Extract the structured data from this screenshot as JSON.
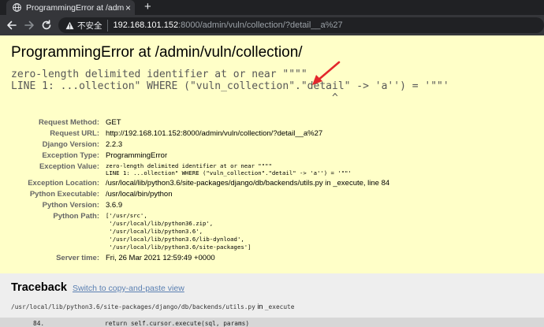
{
  "browser": {
    "tab_title": "ProgrammingError at /admin/vuln/collection/",
    "tab_close": "×",
    "new_tab": "+",
    "insecure_label": "不安全",
    "url_host": "192.168.101.152",
    "url_rest": ":8000/admin/vuln/collection/?detail__a%27"
  },
  "error": {
    "title": "ProgrammingError at /admin/vuln/collection/",
    "message": "zero-length delimited identifier at or near \"\"\"\"\nLINE 1: ...ollection\" WHERE (\"vuln_collection\".\"detail\" -> 'a'') = '\"\"'\n                                                    ^"
  },
  "meta": [
    {
      "label": "Request Method:",
      "value": "GET"
    },
    {
      "label": "Request URL:",
      "value": "http://192.168.101.152:8000/admin/vuln/collection/?detail__a%27"
    },
    {
      "label": "Django Version:",
      "value": "2.2.3"
    },
    {
      "label": "Exception Type:",
      "value": "ProgrammingError"
    },
    {
      "label": "Exception Value:",
      "value": "zero-length delimited identifier at or near \"\"\"\"\nLINE 1: ...ollection\" WHERE (\"vuln_collection\".\"detail\" -> 'a'') = '\"\"'"
    },
    {
      "label": "Exception Location:",
      "value": "/usr/local/lib/python3.6/site-packages/django/db/backends/utils.py in _execute, line 84"
    },
    {
      "label": "Python Executable:",
      "value": "/usr/local/bin/python"
    },
    {
      "label": "Python Version:",
      "value": "3.6.9"
    },
    {
      "label": "Python Path:",
      "value": "['/usr/src',\n '/usr/local/lib/python36.zip',\n '/usr/local/lib/python3.6',\n '/usr/local/lib/python3.6/lib-dynload',\n '/usr/local/lib/python3.6/site-packages']"
    },
    {
      "label": "Server time:",
      "value": "Fri, 26 Mar 2021 12:59:49 +0000"
    }
  ],
  "traceback": {
    "heading": "Traceback",
    "switch_link": "Switch to copy-and-paste view",
    "frame_file": "/usr/local/lib/python3.6/site-packages/django/db/backends/utils.py",
    "frame_in": "in",
    "frame_func": "_execute",
    "line_number": "84.",
    "line_source": "return self.cursor.execute(sql, params)"
  },
  "colors": {
    "summary_bg": "#ffffc8",
    "traceback_bg": "#eeeeee",
    "link": "#5b80b2",
    "arrow": "#e3262b"
  },
  "icons": [
    "globe-icon",
    "close-icon",
    "plus-icon",
    "back-arrow-icon",
    "forward-arrow-icon",
    "reload-icon",
    "warning-icon",
    "red-arrow-annotation"
  ]
}
